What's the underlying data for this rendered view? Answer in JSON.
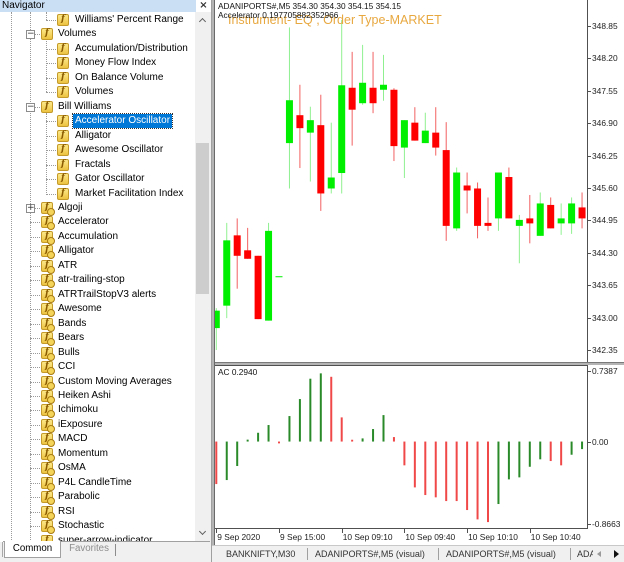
{
  "navigator": {
    "title": "Navigator",
    "close_glyph": "×",
    "items": [
      {
        "label": "Williams' Percent Range",
        "icon": "indicator-icon"
      },
      {
        "label": "Volumes",
        "icon": "indicator-icon",
        "expander": "−"
      },
      {
        "label": "Accumulation/Distribution",
        "icon": "indicator-icon"
      },
      {
        "label": "Money Flow Index",
        "icon": "indicator-icon"
      },
      {
        "label": "On Balance Volume",
        "icon": "indicator-icon"
      },
      {
        "label": "Volumes",
        "icon": "indicator-icon"
      },
      {
        "label": "Bill Williams",
        "icon": "indicator-icon",
        "expander": "−"
      },
      {
        "label": "Accelerator Oscillator",
        "icon": "indicator-icon",
        "selected": true
      },
      {
        "label": "Alligator",
        "icon": "indicator-icon"
      },
      {
        "label": "Awesome Oscillator",
        "icon": "indicator-icon"
      },
      {
        "label": "Fractals",
        "icon": "indicator-icon"
      },
      {
        "label": "Gator Oscillator",
        "icon": "indicator-icon"
      },
      {
        "label": "Market Facilitation Index",
        "icon": "indicator-icon"
      },
      {
        "label": "Algoji",
        "icon": "custom-indicator-icon",
        "expander": "+"
      },
      {
        "label": "Accelerator",
        "icon": "custom-indicator-icon"
      },
      {
        "label": "Accumulation",
        "icon": "custom-indicator-icon"
      },
      {
        "label": "Alligator",
        "icon": "custom-indicator-icon"
      },
      {
        "label": "ATR",
        "icon": "custom-indicator-icon"
      },
      {
        "label": "atr-trailing-stop",
        "icon": "custom-indicator-icon"
      },
      {
        "label": "ATRTrailStopV3 alerts",
        "icon": "custom-indicator-icon"
      },
      {
        "label": "Awesome",
        "icon": "custom-indicator-icon"
      },
      {
        "label": "Bands",
        "icon": "custom-indicator-icon"
      },
      {
        "label": "Bears",
        "icon": "custom-indicator-icon"
      },
      {
        "label": "Bulls",
        "icon": "custom-indicator-icon"
      },
      {
        "label": "CCI",
        "icon": "custom-indicator-icon"
      },
      {
        "label": "Custom Moving Averages",
        "icon": "custom-indicator-icon"
      },
      {
        "label": "Heiken Ashi",
        "icon": "custom-indicator-icon"
      },
      {
        "label": "Ichimoku",
        "icon": "custom-indicator-icon"
      },
      {
        "label": "iExposure",
        "icon": "custom-indicator-icon"
      },
      {
        "label": "MACD",
        "icon": "custom-indicator-icon"
      },
      {
        "label": "Momentum",
        "icon": "custom-indicator-icon"
      },
      {
        "label": "OsMA",
        "icon": "custom-indicator-icon"
      },
      {
        "label": "P4L CandleTime",
        "icon": "custom-indicator-icon"
      },
      {
        "label": "Parabolic",
        "icon": "custom-indicator-icon"
      },
      {
        "label": "RSI",
        "icon": "custom-indicator-icon"
      },
      {
        "label": "Stochastic",
        "icon": "custom-indicator-icon"
      },
      {
        "label": "super-arrow-indicator",
        "icon": "custom-indicator-icon"
      }
    ],
    "tabs": [
      {
        "label": "Common",
        "active": true
      },
      {
        "label": "Favorites",
        "active": false
      }
    ]
  },
  "chart": {
    "header_line1": "ADANIPORTS#,M5  354.30 354.30 354.15 354.15",
    "header_line2": "Accelerator 0.197705882352966",
    "overlay_text": "Instrument- EQ , Order Type-MARKET",
    "ac_label": "AC 0.2940",
    "tabs": [
      {
        "label": "BANKNIFTY,M30"
      },
      {
        "label": "ADANIPORTS#,M5 (visual)"
      },
      {
        "label": "ADANIPORTS#,M5 (visual)"
      },
      {
        "label": "ADA"
      }
    ]
  },
  "colors": {
    "bull_body": "#00ee00",
    "bear_body": "#ff0000",
    "bull_wick": "#8ff08f",
    "bear_wick": "#f26060",
    "ac_up": "#2a8a2a",
    "ac_down": "#f04848",
    "overlay": "#e8a840",
    "selection": "#0078d7"
  },
  "chart_data": [
    {
      "type": "candlestick",
      "title": "ADANIPORTS#,M5",
      "fields": [
        "open",
        "high",
        "low",
        "close"
      ],
      "ohlc": [
        [
          342.79,
          343.19,
          342.35,
          343.14
        ],
        [
          343.24,
          344.9,
          342.99,
          344.55
        ],
        [
          344.65,
          344.99,
          343.58,
          344.24
        ],
        [
          344.35,
          344.8,
          344.18,
          344.18
        ],
        [
          344.24,
          344.24,
          342.97,
          342.97
        ],
        [
          342.94,
          344.9,
          342.94,
          344.74
        ],
        [
          343.83,
          343.83,
          343.83,
          343.83
        ],
        [
          346.5,
          348.82,
          345.59,
          347.36
        ],
        [
          347.06,
          347.67,
          346.0,
          346.8
        ],
        [
          346.71,
          347.23,
          345.73,
          346.96
        ],
        [
          346.86,
          347.47,
          345.14,
          345.49
        ],
        [
          345.59,
          346.91,
          345.49,
          345.81
        ],
        [
          345.9,
          348.97,
          345.49,
          347.66
        ],
        [
          347.61,
          348.33,
          346.45,
          347.17
        ],
        [
          347.3,
          348.47,
          347.27,
          347.71
        ],
        [
          347.61,
          348.33,
          347.1,
          347.3
        ],
        [
          347.57,
          348.27,
          347.35,
          347.67
        ],
        [
          347.57,
          347.6,
          346.14,
          346.44
        ],
        [
          346.41,
          346.96,
          345.8,
          346.96
        ],
        [
          346.91,
          347.22,
          346.55,
          346.55
        ],
        [
          346.5,
          347.11,
          346.5,
          346.75
        ],
        [
          346.71,
          347.22,
          346.25,
          346.41
        ],
        [
          346.36,
          346.92,
          344.54,
          344.84
        ],
        [
          344.79,
          346.01,
          344.74,
          345.91
        ],
        [
          345.65,
          345.91,
          345.09,
          345.55
        ],
        [
          345.59,
          345.71,
          344.59,
          344.84
        ],
        [
          344.9,
          345.41,
          344.74,
          344.84
        ],
        [
          344.99,
          345.91,
          344.74,
          345.91
        ],
        [
          345.82,
          346.01,
          344.99,
          344.99
        ],
        [
          344.84,
          345.06,
          344.09,
          344.96
        ],
        [
          344.99,
          345.46,
          344.49,
          344.89
        ],
        [
          344.64,
          345.51,
          344.64,
          345.29
        ],
        [
          345.26,
          345.41,
          344.79,
          344.79
        ],
        [
          344.89,
          345.29,
          344.66,
          344.99
        ],
        [
          344.89,
          345.41,
          344.68,
          345.29
        ],
        [
          345.21,
          345.51,
          344.79,
          344.99
        ]
      ],
      "yticks": [
        "348.85",
        "348.20",
        "347.55",
        "346.90",
        "346.25",
        "345.60",
        "344.95",
        "344.30",
        "343.65",
        "343.00",
        "342.35"
      ],
      "ylim": [
        342.11,
        349.37
      ],
      "xticks": [
        {
          "index": 0,
          "label": "9 Sep 2020"
        },
        {
          "index": 6,
          "label": "9 Sep 15:00"
        },
        {
          "index": 12,
          "label": "10 Sep 09:10"
        },
        {
          "index": 18,
          "label": "10 Sep 09:40"
        },
        {
          "index": 24,
          "label": "10 Sep 10:10"
        },
        {
          "index": 30,
          "label": "10 Sep 10:40"
        }
      ],
      "grid": false
    },
    {
      "type": "bar",
      "title": "AC 0.2940",
      "values": [
        -0.445,
        -0.403,
        -0.256,
        0.02,
        0.092,
        0.173,
        -0.019,
        0.267,
        0.445,
        0.658,
        0.714,
        0.678,
        0.253,
        0.019,
        0.033,
        0.131,
        0.277,
        0.047,
        -0.249,
        -0.48,
        -0.56,
        -0.584,
        -0.623,
        -0.623,
        -0.717,
        -0.815,
        -0.843,
        -0.654,
        -0.396,
        -0.375,
        -0.264,
        -0.186,
        -0.204,
        -0.249,
        -0.138,
        -0.079
      ],
      "yticks": [
        "0.7387",
        "0.00",
        "-0.8663"
      ],
      "ylim": [
        -0.905,
        0.791
      ],
      "color_rule": "up vs previous bar = ac_up, otherwise ac_down",
      "grid": false
    }
  ]
}
